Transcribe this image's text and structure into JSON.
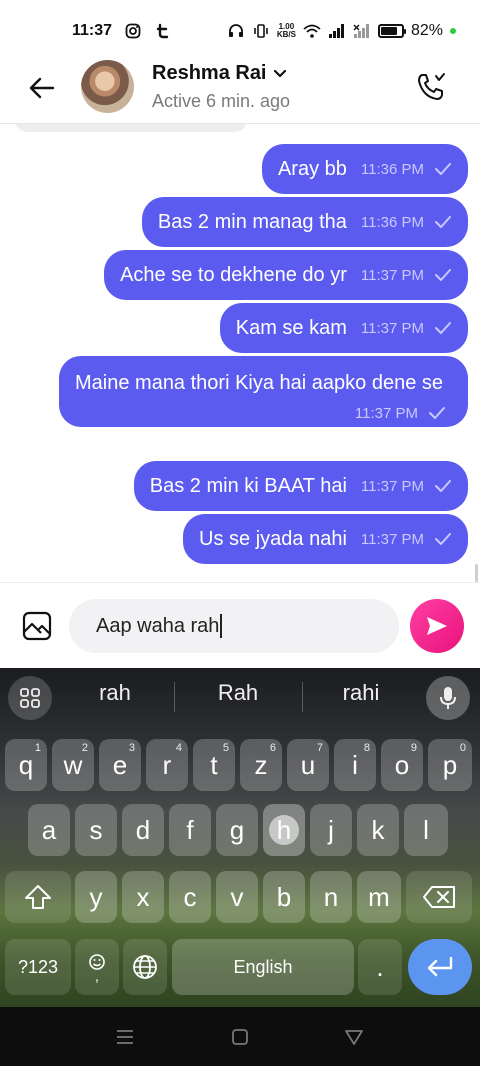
{
  "status_bar": {
    "time": "11:37",
    "netspeed_value": "1.00",
    "netspeed_unit": "KB/S",
    "battery_percent": "82%",
    "battery_level": 0.82
  },
  "header": {
    "contact_name": "Reshma Rai",
    "contact_status": "Active 6 min. ago"
  },
  "messages": [
    {
      "text": "Aray bb",
      "time": "11:36 PM"
    },
    {
      "text": "Bas 2 min manag tha",
      "time": "11:36 PM"
    },
    {
      "text": "Ache se to dekhene do yr",
      "time": "11:37 PM"
    },
    {
      "text": "Kam se kam",
      "time": "11:37 PM"
    },
    {
      "text": "Maine mana thori Kiya hai aapko dene se",
      "time": "11:37 PM"
    },
    {
      "text": "Bas 2 min ki BAAT hai",
      "time": "11:37 PM"
    },
    {
      "text": "Us se jyada nahi",
      "time": "11:37 PM"
    }
  ],
  "composer": {
    "input_value": "Aap waha rah"
  },
  "keyboard": {
    "suggestions": [
      "rah",
      "Rah",
      "rahi"
    ],
    "row1": [
      {
        "ch": "q",
        "hint": "1"
      },
      {
        "ch": "w",
        "hint": "2"
      },
      {
        "ch": "e",
        "hint": "3"
      },
      {
        "ch": "r",
        "hint": "4"
      },
      {
        "ch": "t",
        "hint": "5"
      },
      {
        "ch": "z",
        "hint": "6"
      },
      {
        "ch": "u",
        "hint": "7"
      },
      {
        "ch": "i",
        "hint": "8"
      },
      {
        "ch": "o",
        "hint": "9"
      },
      {
        "ch": "p",
        "hint": "0"
      }
    ],
    "row2": [
      "a",
      "s",
      "d",
      "f",
      "g",
      "h",
      "j",
      "k",
      "l"
    ],
    "row3": [
      "y",
      "x",
      "c",
      "v",
      "b",
      "n",
      "m"
    ],
    "symbols_label": "?123",
    "space_label": "English",
    "period_label": "."
  },
  "colors": {
    "bubble": "#5b5bf0",
    "send": "#e8137c",
    "enter": "#5b95f0"
  }
}
